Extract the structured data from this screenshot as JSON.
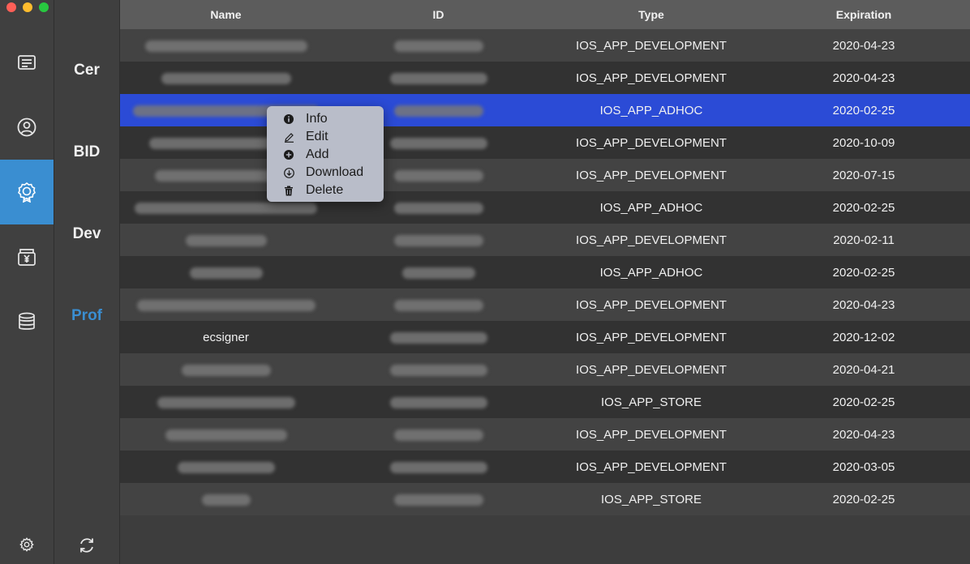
{
  "sidebar": {
    "items": [
      {
        "icon": "certificate-list-icon",
        "active": false
      },
      {
        "icon": "user-circle-icon",
        "active": false
      },
      {
        "icon": "badge-icon",
        "active": true
      },
      {
        "icon": "wallet-yen-icon",
        "active": false
      },
      {
        "icon": "database-icon",
        "active": false
      }
    ],
    "settings_icon": "gear-icon"
  },
  "categories": [
    {
      "label": "Cer",
      "active": false
    },
    {
      "label": "BID",
      "active": false
    },
    {
      "label": "Dev",
      "active": false
    },
    {
      "label": "Prof",
      "active": true
    }
  ],
  "refresh_icon": "refresh-icon",
  "table": {
    "headers": {
      "name": "Name",
      "id": "ID",
      "type": "Type",
      "expiration": "Expiration"
    },
    "rows": [
      {
        "name": "",
        "id": "",
        "type": "IOS_APP_DEVELOPMENT",
        "expiration": "2020-04-23"
      },
      {
        "name": "",
        "id": "",
        "type": "IOS_APP_DEVELOPMENT",
        "expiration": "2020-04-23"
      },
      {
        "name": "",
        "id": "",
        "type": "IOS_APP_ADHOC",
        "expiration": "2020-02-25"
      },
      {
        "name": "",
        "id": "",
        "type": "IOS_APP_DEVELOPMENT",
        "expiration": "2020-10-09"
      },
      {
        "name": "",
        "id": "",
        "type": "IOS_APP_DEVELOPMENT",
        "expiration": "2020-07-15"
      },
      {
        "name": "",
        "id": "",
        "type": "IOS_APP_ADHOC",
        "expiration": "2020-02-25"
      },
      {
        "name": "",
        "id": "",
        "type": "IOS_APP_DEVELOPMENT",
        "expiration": "2020-02-11"
      },
      {
        "name": "",
        "id": "",
        "type": "IOS_APP_ADHOC",
        "expiration": "2020-02-25"
      },
      {
        "name": "",
        "id": "",
        "type": "IOS_APP_DEVELOPMENT",
        "expiration": "2020-04-23"
      },
      {
        "name": "ecsigner",
        "id": "",
        "type": "IOS_APP_DEVELOPMENT",
        "expiration": "2020-12-02"
      },
      {
        "name": "",
        "id": "",
        "type": "IOS_APP_DEVELOPMENT",
        "expiration": "2020-04-21"
      },
      {
        "name": "",
        "id": "",
        "type": "IOS_APP_STORE",
        "expiration": "2020-02-25"
      },
      {
        "name": "",
        "id": "",
        "type": "IOS_APP_DEVELOPMENT",
        "expiration": "2020-04-23"
      },
      {
        "name": "",
        "id": "",
        "type": "IOS_APP_DEVELOPMENT",
        "expiration": "2020-03-05"
      },
      {
        "name": "",
        "id": "",
        "type": "IOS_APP_STORE",
        "expiration": "2020-02-25"
      }
    ],
    "selected_row": 2
  },
  "context_menu": {
    "items": [
      {
        "label": "Info",
        "icon": "info-icon"
      },
      {
        "label": "Edit",
        "icon": "pencil-icon"
      },
      {
        "label": "Add",
        "icon": "plus-circle-icon"
      },
      {
        "label": "Download",
        "icon": "download-icon"
      },
      {
        "label": "Delete",
        "icon": "trash-icon"
      }
    ]
  },
  "colors": {
    "accent": "#3a8ed1",
    "selection": "#2b4bd6"
  }
}
